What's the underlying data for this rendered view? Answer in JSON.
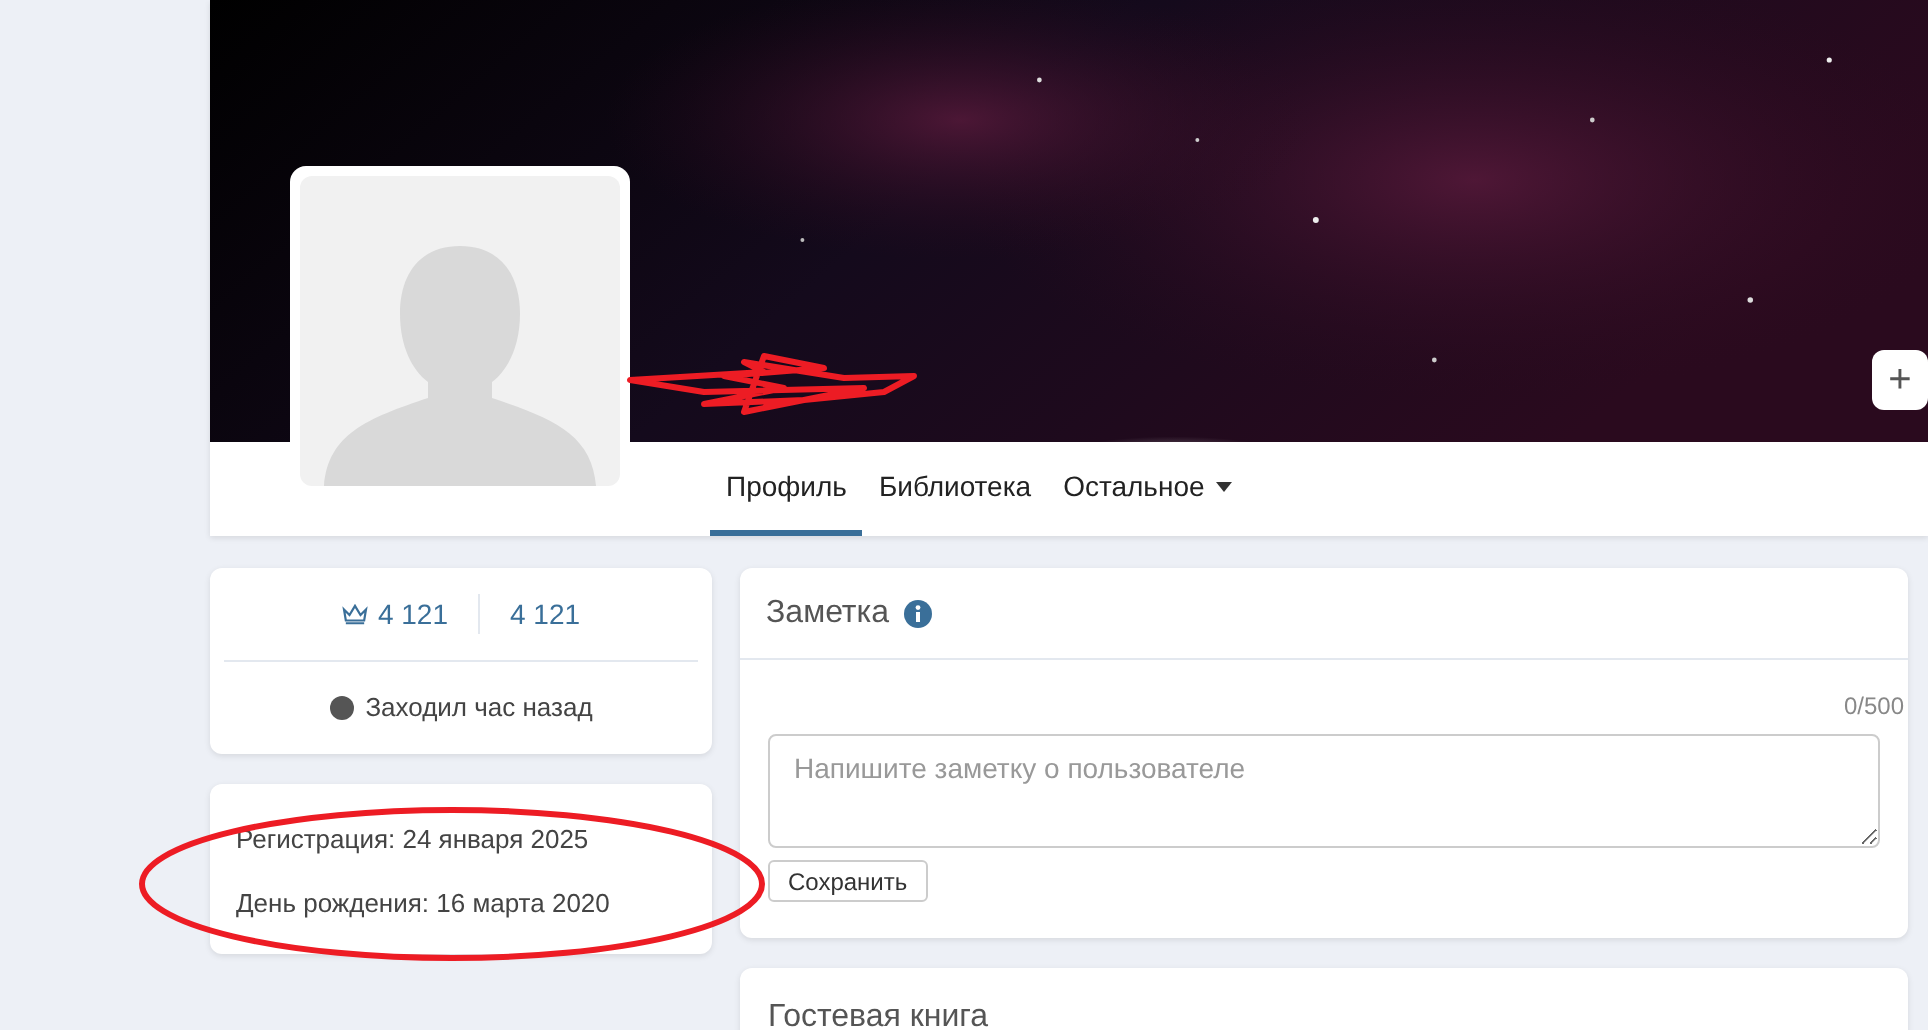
{
  "tabs": [
    {
      "label": "Профиль",
      "selected": true
    },
    {
      "label": "Библиотека",
      "selected": false
    },
    {
      "label": "Остальное",
      "selected": false,
      "dropdown": true
    }
  ],
  "add_button": {
    "label": "+"
  },
  "stats": [
    {
      "value": "4 121",
      "kind": "crown"
    },
    {
      "value": "4 121",
      "kind": "plain"
    }
  ],
  "status": {
    "text": "Заходил час назад",
    "online": false
  },
  "info": [
    "Регистрация: 24 января 2025",
    "День рождения: 16 марта 2020"
  ],
  "note": {
    "title": "Заметка",
    "counter": "0/500",
    "placeholder": "Напишите заметку о пользователе",
    "button": "Сохранить"
  },
  "guestbook": {
    "title": "Гостевая книга"
  }
}
